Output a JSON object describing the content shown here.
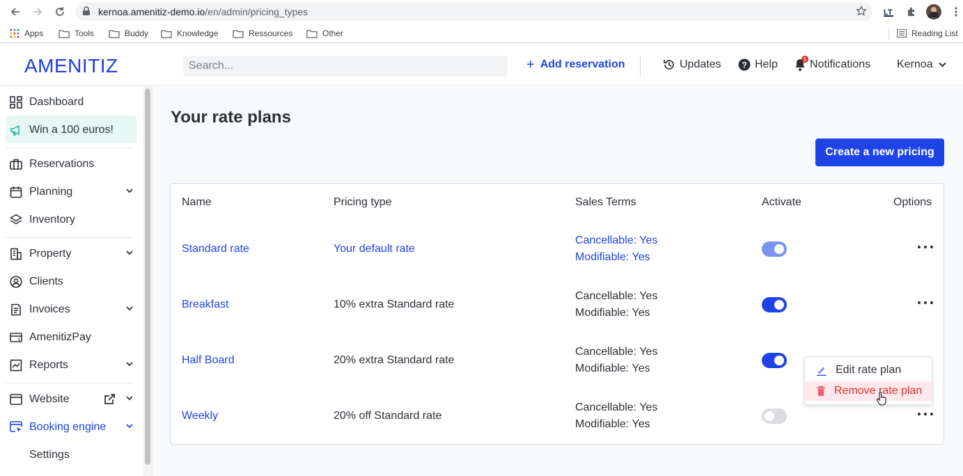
{
  "browser": {
    "url_host": "kernoa.amenitiz-demo.io",
    "url_path": "/en/admin/pricing_types",
    "bookmarks": [
      "Apps",
      "Tools",
      "Buddy",
      "Knowledge",
      "Ressources",
      "Other"
    ],
    "reading_list": "Reading List"
  },
  "header": {
    "logo": "AMENITIZ",
    "search_placeholder": "Search...",
    "add_reservation": "Add reservation",
    "updates": "Updates",
    "help": "Help",
    "notifications": "Notifications",
    "notifications_count": "1",
    "user": "Kernoa"
  },
  "sidebar": {
    "items": [
      {
        "label": "Dashboard",
        "icon": "dashboard-icon"
      },
      {
        "label": "Win a 100 euros!",
        "icon": "megaphone-icon"
      },
      {
        "label": "Reservations",
        "icon": "briefcase-icon"
      },
      {
        "label": "Planning",
        "icon": "calendar-icon"
      },
      {
        "label": "Inventory",
        "icon": "layers-icon"
      },
      {
        "label": "Property",
        "icon": "building-icon"
      },
      {
        "label": "Clients",
        "icon": "user-circle-icon"
      },
      {
        "label": "Invoices",
        "icon": "invoice-icon"
      },
      {
        "label": "AmenitizPay",
        "icon": "card-reader-icon"
      },
      {
        "label": "Reports",
        "icon": "chart-icon"
      },
      {
        "label": "Website",
        "icon": "browser-icon"
      },
      {
        "label": "Booking engine",
        "icon": "cursor-window-icon"
      },
      {
        "label": "Settings",
        "icon": ""
      }
    ]
  },
  "main": {
    "title": "Your rate plans",
    "create_button": "Create a new pricing",
    "table": {
      "headers": [
        "Name",
        "Pricing type",
        "Sales Terms",
        "Activate",
        "Options"
      ],
      "rows": [
        {
          "name": "Standard rate",
          "pricing_type": "Your default rate",
          "cancellable": "Cancellable: Yes",
          "modifiable": "Modifiable: Yes",
          "active": "default"
        },
        {
          "name": "Breakfast",
          "pricing_type": "10% extra Standard rate",
          "cancellable": "Cancellable: Yes",
          "modifiable": "Modifiable: Yes",
          "active": "on"
        },
        {
          "name": "Half Board",
          "pricing_type": "20% extra Standard rate",
          "cancellable": "Cancellable: Yes",
          "modifiable": "Modifiable: Yes",
          "active": "on"
        },
        {
          "name": "Weekly",
          "pricing_type": "20% off Standard rate",
          "cancellable": "Cancellable: Yes",
          "modifiable": "Modifiable: Yes",
          "active": "off"
        }
      ]
    },
    "options_menu": {
      "edit": "Edit rate plan",
      "remove": "Remove rate plan"
    }
  },
  "colors": {
    "accent": "#1e44e8",
    "danger": "#e0302b",
    "promo_bg": "#e7f8f4"
  }
}
